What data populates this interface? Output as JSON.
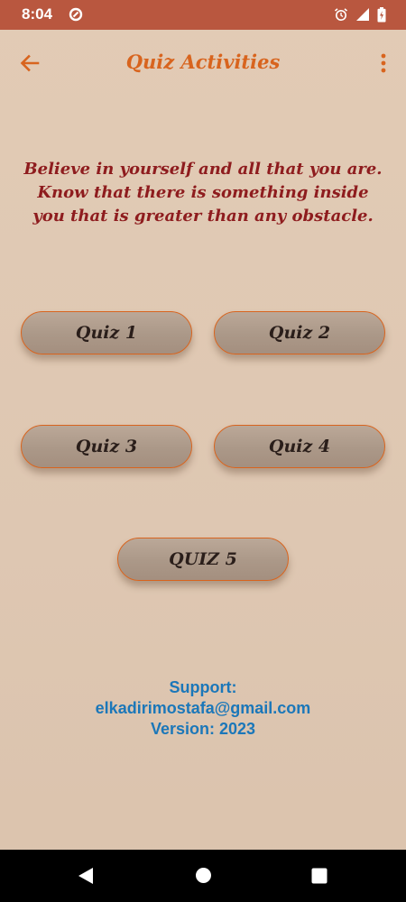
{
  "status_bar": {
    "time": "8:04",
    "icons": [
      "data-saver-icon",
      "alarm-icon",
      "signal-icon",
      "battery-icon"
    ],
    "color": "#b9573f"
  },
  "app_bar": {
    "title": "Quiz Activities",
    "back_icon": "arrow-left-icon",
    "menu_icon": "more-vert-icon",
    "accent": "#d8641e"
  },
  "quote": {
    "text": "Believe in yourself and all that you are. Know that there is something inside you that is greater than any obstacle.",
    "color": "#8e1c1e"
  },
  "quizzes": [
    {
      "label": "Quiz 1"
    },
    {
      "label": "Quiz 2"
    },
    {
      "label": "Quiz 3"
    },
    {
      "label": "Quiz 4"
    },
    {
      "label": "QUIZ 5"
    }
  ],
  "support": {
    "label": "Support:",
    "email": "elkadirimostafa@gmail.com",
    "version": "Version: 2023",
    "color": "#1b77b9"
  },
  "nav_bar": {
    "icons": [
      "nav-back-icon",
      "nav-home-icon",
      "nav-recents-icon"
    ]
  }
}
